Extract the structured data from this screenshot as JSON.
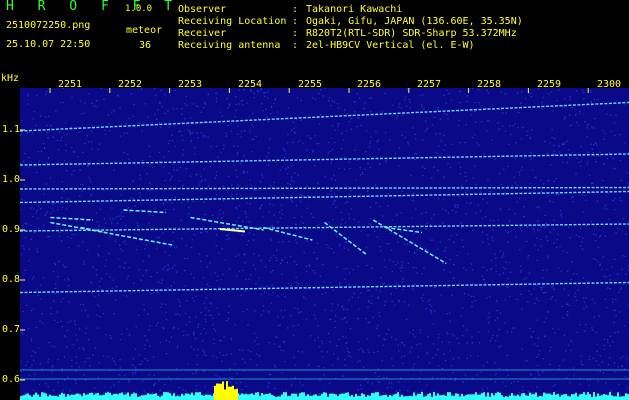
{
  "header": {
    "app_title": "H R O F F T",
    "app_version": "1.0.0",
    "file_name": "2510072250.png",
    "mode_label": "meteor",
    "timestamp": "25.10.07 22:50",
    "count_value": "36"
  },
  "station_info": [
    {
      "key": "Observer",
      "sep": ":",
      "value": "Takanori Kawachi"
    },
    {
      "key": "Receiving Location",
      "sep": ":",
      "value": "Ogaki, Gifu, JAPAN (136.60E, 35.35N)"
    },
    {
      "key": "Receiver",
      "sep": ":",
      "value": "R820T2(RTL-SDR) SDR-Sharp 53.372MHz"
    },
    {
      "key": "Receiving antenna",
      "sep": ":",
      "value": "2el-HB9CV Vertical (el. E-W)"
    }
  ],
  "spectrogram": {
    "unit_label": "kHz",
    "time_labels": [
      "2251",
      "2252",
      "2253",
      "2254",
      "2255",
      "2256",
      "2257",
      "2258",
      "2259",
      "2300"
    ],
    "freq_labels": [
      "1.1",
      "1.0",
      "0.9",
      "0.8",
      "0.7",
      "0.6"
    ],
    "freq_values": [
      1.1,
      1.0,
      0.9,
      0.8,
      0.7,
      0.6
    ],
    "freq_range": [
      0.58,
      1.2
    ],
    "colors": {
      "background": "#0a0a88",
      "noise": "#2a3ce8",
      "trace": "#7fe7ff",
      "trace_hot": "#ffffa0",
      "meteor": "#6ef0ff",
      "ticks": "#ffff33",
      "baseline": "#33ffff",
      "level_peak": "#ffff00"
    },
    "carriers": [
      {
        "f_start": 1.098,
        "f_end": 1.155
      },
      {
        "f_start": 1.03,
        "f_end": 1.052
      },
      {
        "f_start": 0.982,
        "f_end": 0.985
      },
      {
        "f_start": 0.955,
        "f_end": 0.977
      },
      {
        "f_start": 0.898,
        "f_end": 0.912
      },
      {
        "f_start": 0.775,
        "f_end": 0.795
      }
    ],
    "meteor_streaks": [
      {
        "t0": 0.05,
        "f0": 0.925,
        "t1": 0.12,
        "f1": 0.92
      },
      {
        "t0": 0.1,
        "f0": 0.905,
        "t1": 0.14,
        "f1": 0.895
      },
      {
        "t0": 0.05,
        "f0": 0.915,
        "t1": 0.25,
        "f1": 0.87
      },
      {
        "t0": 0.17,
        "f0": 0.94,
        "t1": 0.24,
        "f1": 0.935
      },
      {
        "t0": 0.28,
        "f0": 0.925,
        "t1": 0.4,
        "f1": 0.9
      },
      {
        "t0": 0.4,
        "f0": 0.905,
        "t1": 0.48,
        "f1": 0.88
      },
      {
        "t0": 0.5,
        "f0": 0.915,
        "t1": 0.57,
        "f1": 0.85
      },
      {
        "t0": 0.58,
        "f0": 0.92,
        "t1": 0.7,
        "f1": 0.833
      },
      {
        "t0": 0.6,
        "f0": 0.905,
        "t1": 0.66,
        "f1": 0.895
      }
    ]
  }
}
